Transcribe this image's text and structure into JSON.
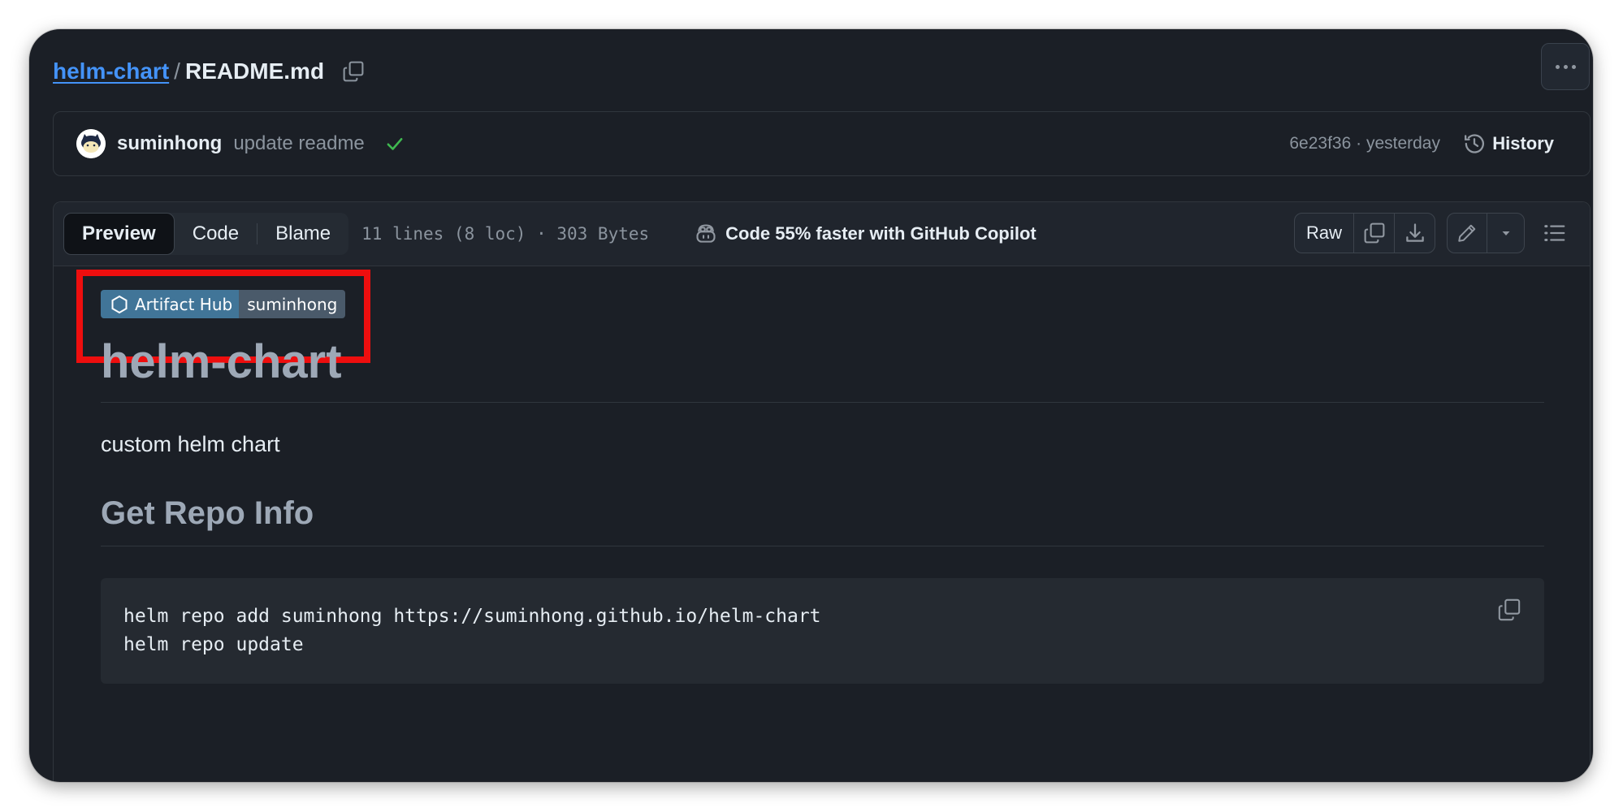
{
  "header": {
    "repo_link": "helm-chart",
    "separator": "/",
    "file_name": "README.md"
  },
  "commit": {
    "author": "suminhong",
    "message": "update readme",
    "meta": "6e23f36 · yesterday",
    "history_label": "History"
  },
  "toolbar": {
    "tabs": [
      {
        "label": "Preview",
        "active": true
      },
      {
        "label": "Code",
        "active": false
      },
      {
        "label": "Blame",
        "active": false
      }
    ],
    "file_stats": "11 lines (8 loc) · 303 Bytes",
    "copilot_label": "Code 55% faster with GitHub Copilot",
    "raw_label": "Raw"
  },
  "readme": {
    "badge_left": "Artifact Hub",
    "badge_right": "suminhong",
    "title": "helm-chart",
    "description": "custom helm chart",
    "section_heading": "Get Repo Info",
    "code_lines": [
      "helm repo add suminhong https://suminhong.github.io/helm-chart",
      "helm repo update"
    ]
  },
  "colors": {
    "background": "#1b1f26",
    "link": "#4493f8",
    "highlight_box": "#ee0e0e",
    "check": "#3fb950",
    "badge_left": "#417598",
    "badge_right": "#4a5a6a"
  },
  "icons": {
    "copy_path": "copy-icon",
    "kebab": "kebab-horizontal-icon",
    "check": "check-icon",
    "history": "history-icon",
    "copilot": "copilot-icon",
    "copy": "copy-icon",
    "download": "download-icon",
    "edit": "pencil-icon",
    "dropdown": "triangle-down-icon",
    "outline": "list-unordered-icon",
    "badge": "hexagon-icon"
  }
}
